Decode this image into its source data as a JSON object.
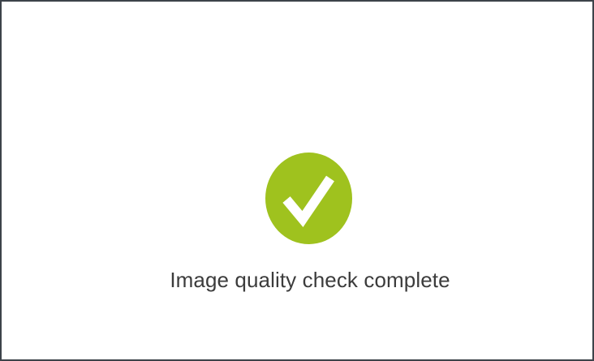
{
  "status": {
    "message": "Image quality check complete",
    "icon": "checkmark-icon",
    "accent_color": "#9fc21e"
  }
}
